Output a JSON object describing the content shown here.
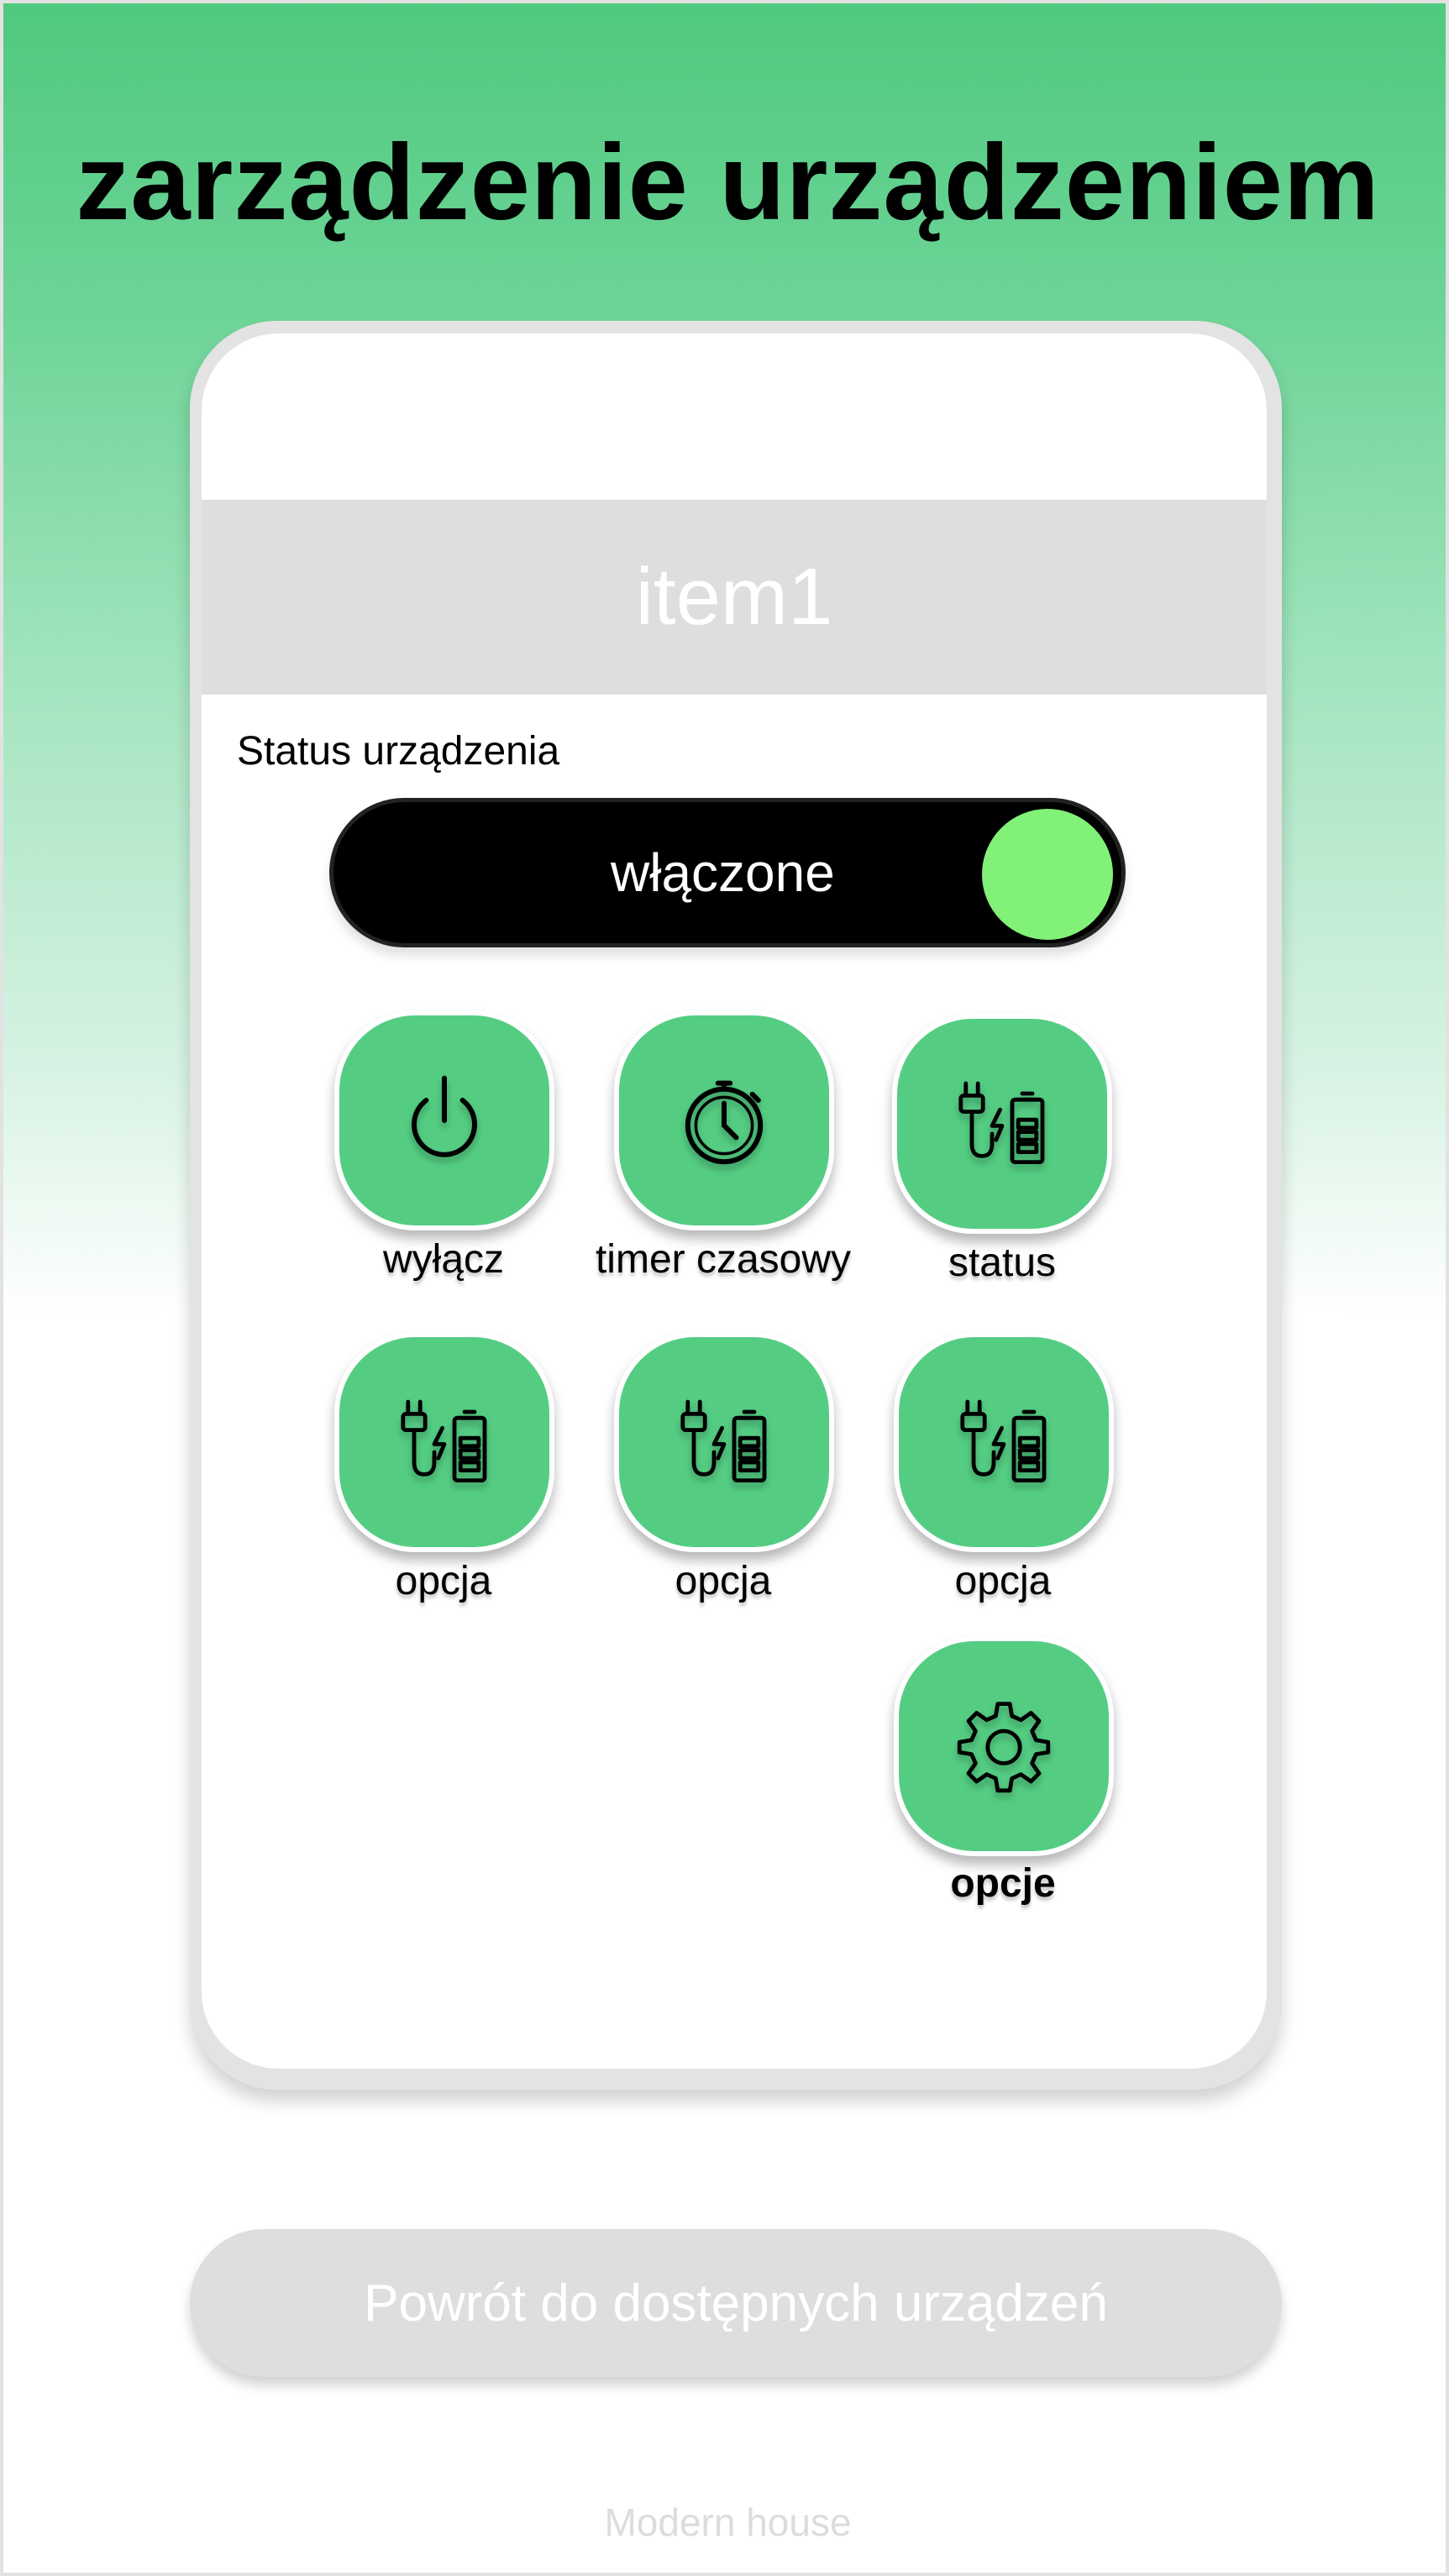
{
  "header": {
    "title": "zarządzenie urządzeniem"
  },
  "device": {
    "name": "item1",
    "status_label": "Status urządzenia",
    "toggle": {
      "text": "włączone",
      "on": true
    }
  },
  "actions": [
    {
      "label": "wyłącz",
      "icon": "power-icon"
    },
    {
      "label": "timer czasowy",
      "icon": "stopwatch-icon"
    },
    {
      "label": "status",
      "icon": "plug-battery-icon"
    },
    {
      "label": "opcja",
      "icon": "plug-battery-icon"
    },
    {
      "label": "opcja",
      "icon": "plug-battery-icon"
    },
    {
      "label": "opcja",
      "icon": "plug-battery-icon"
    },
    {
      "label": "opcje",
      "icon": "gear-icon"
    }
  ],
  "back_button": {
    "label": "Powrót do dostępnych urządzeń"
  },
  "footer": {
    "text": "Modern house"
  },
  "colors": {
    "accent_green": "#54cd83",
    "toggle_knob": "#81f178",
    "toggle_track": "#000000",
    "muted_gray": "#dedede"
  }
}
